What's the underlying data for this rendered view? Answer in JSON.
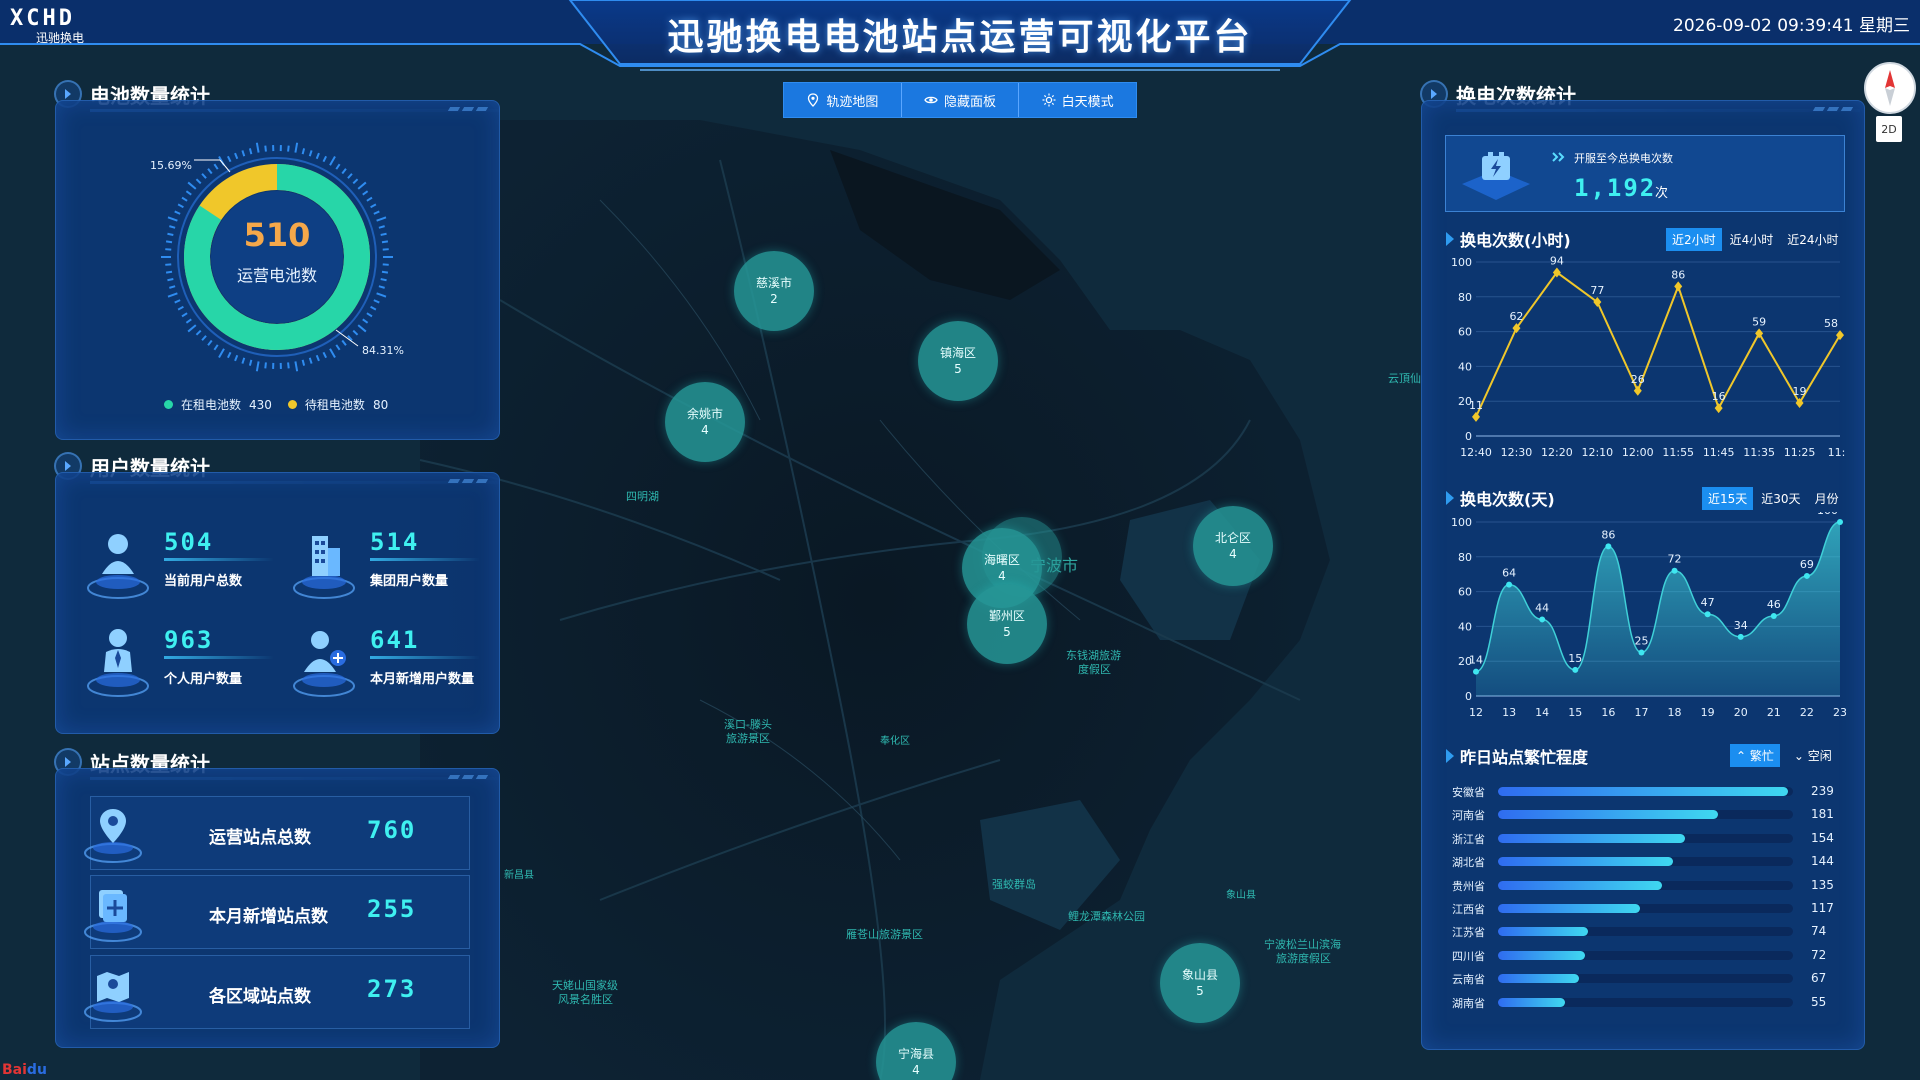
{
  "header": {
    "logo_main": "XCHD",
    "logo_sub": "迅驰换电",
    "title": "迅驰换电电池站点运营可视化平台",
    "datetime": "2026-09-02 09:39:41 星期三"
  },
  "toolbar": {
    "buttons": [
      {
        "label": "轨迹地图",
        "icon": "map-pin-icon"
      },
      {
        "label": "隐藏面板",
        "icon": "eye-icon"
      },
      {
        "label": "白天模式",
        "icon": "sun-icon"
      }
    ]
  },
  "battery_panel": {
    "title": "电池数量统计",
    "total": "510",
    "total_label": "运营电池数",
    "pct_small": "15.69%",
    "pct_large": "84.31%",
    "in_rent_share": 0.8431,
    "legend": [
      {
        "label": "在租电池数",
        "value": "430",
        "color": "#27d6a8"
      },
      {
        "label": "待租电池数",
        "value": "80",
        "color": "#f0c72a"
      }
    ]
  },
  "user_panel": {
    "title": "用户数量统计",
    "items": [
      {
        "value": "504",
        "label": "当前用户总数",
        "icon": "user-icon"
      },
      {
        "value": "514",
        "label": "集团用户数量",
        "icon": "building-icon"
      },
      {
        "value": "963",
        "label": "个人用户数量",
        "icon": "person-icon"
      },
      {
        "value": "641",
        "label": "本月新增用户数量",
        "icon": "add-user-icon"
      }
    ]
  },
  "site_panel": {
    "title": "站点数量统计",
    "items": [
      {
        "label": "运营站点总数",
        "value": "760",
        "icon": "location-pin-icon"
      },
      {
        "label": "本月新增站点数",
        "value": "255",
        "icon": "add-site-icon"
      },
      {
        "label": "各区域站点数",
        "value": "273",
        "icon": "map-region-icon"
      }
    ]
  },
  "swap_panel": {
    "title": "换电次数统计",
    "summary_label": "开服至今总换电次数",
    "summary_value": "1,192",
    "summary_unit": "次",
    "hourly_title": "换电次数(小时)",
    "hourly_buttons": [
      "近2小时",
      "近4小时",
      "近24小时"
    ],
    "daily_title": "换电次数(天)",
    "daily_buttons": [
      "近15天",
      "近30天",
      "月份"
    ],
    "busy_title": "昨日站点繁忙程度",
    "busy_buttons": [
      "繁忙",
      "空闲"
    ]
  },
  "chart_data": [
    {
      "type": "line",
      "title": "换电次数(小时)",
      "x": [
        "12:40",
        "12:30",
        "12:20",
        "12:10",
        "12:00",
        "11:55",
        "11:45",
        "11:35",
        "11:25",
        "11:1"
      ],
      "values": [
        11,
        62,
        94,
        77,
        26,
        86,
        16,
        59,
        19,
        58
      ],
      "ylim": [
        0,
        100
      ],
      "yticks": [
        0,
        20,
        40,
        60,
        80,
        100
      ],
      "color": "#f0c72a"
    },
    {
      "type": "area",
      "title": "换电次数(天)",
      "x": [
        "12",
        "13",
        "14",
        "15",
        "16",
        "17",
        "18",
        "19",
        "20",
        "21",
        "22",
        "23"
      ],
      "values": [
        14,
        64,
        44,
        15,
        86,
        25,
        72,
        47,
        34,
        46,
        69,
        100
      ],
      "ylim": [
        0,
        100
      ],
      "yticks": [
        0,
        20,
        40,
        60,
        80,
        100
      ],
      "color": "#3fd0d8"
    },
    {
      "type": "bar",
      "title": "昨日站点繁忙程度",
      "categories": [
        "安徽省",
        "河南省",
        "浙江省",
        "湖北省",
        "贵州省",
        "江西省",
        "江苏省",
        "四川省",
        "云南省",
        "湖南省"
      ],
      "values": [
        239,
        181,
        154,
        144,
        135,
        117,
        74,
        72,
        67,
        55
      ],
      "max": 239
    }
  ],
  "map": {
    "clusters": [
      {
        "name": "慈溪市",
        "count": "2"
      },
      {
        "name": "镇海区",
        "count": "5"
      },
      {
        "name": "余姚市",
        "count": "4"
      },
      {
        "name": "北仑区",
        "count": "4"
      },
      {
        "name": "海曙区",
        "count": "4"
      },
      {
        "name": "鄞州区",
        "count": "5"
      },
      {
        "name": "象山县",
        "count": "5"
      },
      {
        "name": "宁海县",
        "count": "4"
      }
    ],
    "labels": [
      "四明湖",
      "东钱湖旅游",
      "度假区",
      "溪口-滕头",
      "旅游景区",
      "奉化区",
      "新昌县",
      "天姥山国家级",
      "风景名胜区",
      "雁苍山旅游景区",
      "强蛟群岛",
      "鲤龙潭森林公园",
      "宁波松兰山滨海",
      "旅游度假区",
      "象山县",
      "云頂仙",
      "宁波市"
    ]
  }
}
